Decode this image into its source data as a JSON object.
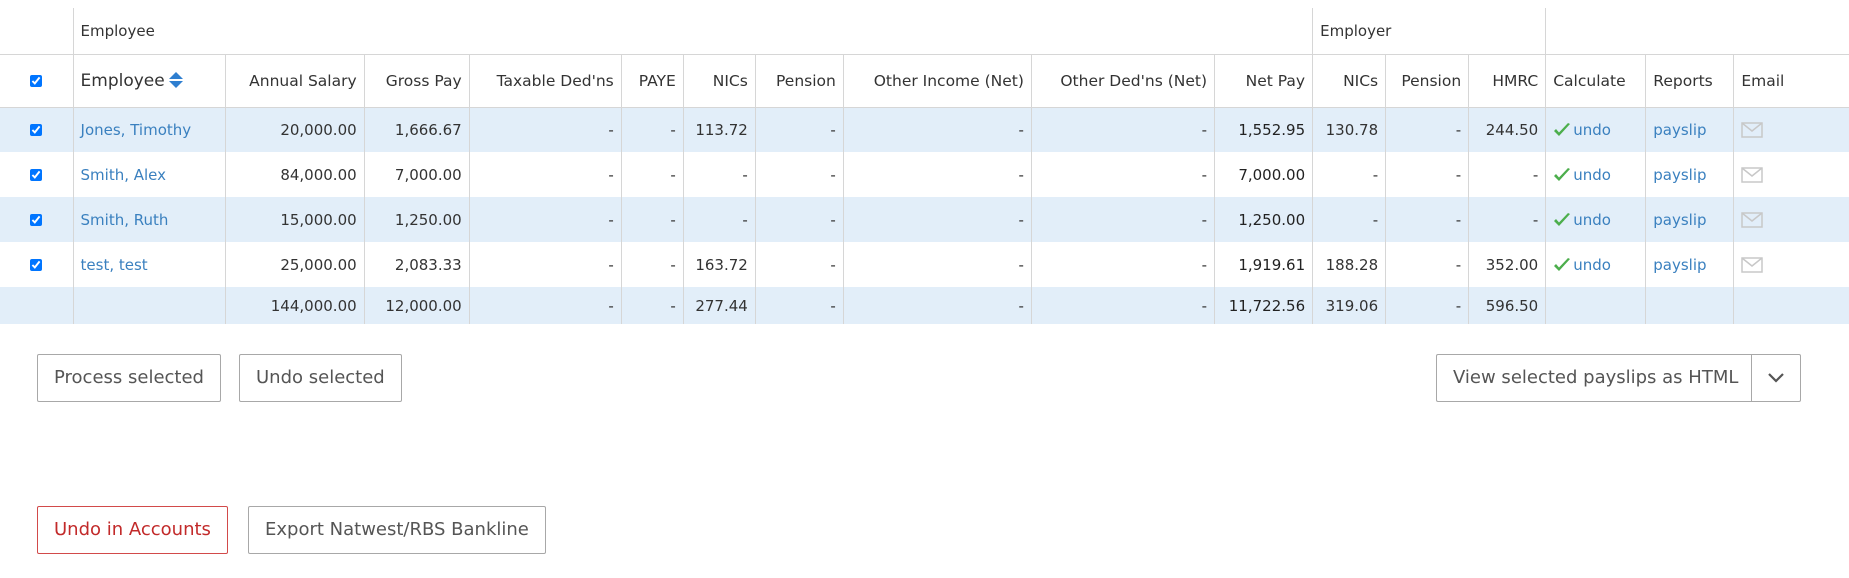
{
  "groups": {
    "employee": "Employee",
    "employer": "Employer"
  },
  "headers": {
    "employee": "Employee",
    "annual_salary": "Annual Salary",
    "gross_pay": "Gross Pay",
    "taxable_deds": "Taxable Ded'ns",
    "paye": "PAYE",
    "nics": "NICs",
    "pension": "Pension",
    "other_income": "Other Income (Net)",
    "other_deds": "Other Ded'ns (Net)",
    "net_pay": "Net Pay",
    "er_nics": "NICs",
    "er_pension": "Pension",
    "hmrc": "HMRC",
    "calculate": "Calculate",
    "reports": "Reports",
    "email": "Email"
  },
  "icons": {
    "sort": "sort-up-down-icon",
    "calculated": "check-icon",
    "email": "envelope-icon",
    "dropdown": "chevron-down-icon"
  },
  "colors": {
    "link": "#3a80bf",
    "stripe": "#e2eef9",
    "check": "#4cae4c",
    "sort": "#2f7fd0",
    "danger": "#c22a2a"
  },
  "rows": [
    {
      "selected": true,
      "name": "Jones, Timothy",
      "annual_salary": "20,000.00",
      "gross_pay": "1,666.67",
      "taxable_deds": "-",
      "paye": "-",
      "nics": "113.72",
      "pension": "-",
      "other_income": "-",
      "other_deds": "-",
      "net_pay": "1,552.95",
      "er_nics": "130.78",
      "er_pension": "-",
      "hmrc": "244.50",
      "calculate": "undo",
      "report": "payslip"
    },
    {
      "selected": true,
      "name": "Smith, Alex",
      "annual_salary": "84,000.00",
      "gross_pay": "7,000.00",
      "taxable_deds": "-",
      "paye": "-",
      "nics": "-",
      "pension": "-",
      "other_income": "-",
      "other_deds": "-",
      "net_pay": "7,000.00",
      "er_nics": "-",
      "er_pension": "-",
      "hmrc": "-",
      "calculate": "undo",
      "report": "payslip"
    },
    {
      "selected": true,
      "name": "Smith, Ruth",
      "annual_salary": "15,000.00",
      "gross_pay": "1,250.00",
      "taxable_deds": "-",
      "paye": "-",
      "nics": "-",
      "pension": "-",
      "other_income": "-",
      "other_deds": "-",
      "net_pay": "1,250.00",
      "er_nics": "-",
      "er_pension": "-",
      "hmrc": "-",
      "calculate": "undo",
      "report": "payslip"
    },
    {
      "selected": true,
      "name": "test, test",
      "annual_salary": "25,000.00",
      "gross_pay": "2,083.33",
      "taxable_deds": "-",
      "paye": "-",
      "nics": "163.72",
      "pension": "-",
      "other_income": "-",
      "other_deds": "-",
      "net_pay": "1,919.61",
      "er_nics": "188.28",
      "er_pension": "-",
      "hmrc": "352.00",
      "calculate": "undo",
      "report": "payslip"
    }
  ],
  "totals": {
    "annual_salary": "144,000.00",
    "gross_pay": "12,000.00",
    "taxable_deds": "-",
    "paye": "-",
    "nics": "277.44",
    "pension": "-",
    "other_income": "-",
    "other_deds": "-",
    "net_pay": "11,722.56",
    "er_nics": "319.06",
    "er_pension": "-",
    "hmrc": "596.50"
  },
  "actions": {
    "process_selected": "Process selected",
    "undo_selected": "Undo selected",
    "view_payslips": "View selected payslips as HTML",
    "undo_in_accounts": "Undo in Accounts",
    "export_bankline": "Export Natwest/RBS Bankline"
  }
}
